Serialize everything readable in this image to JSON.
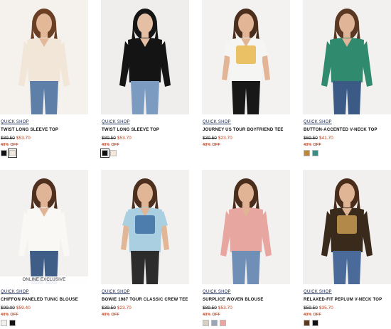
{
  "products": [
    {
      "quick_shop": "QUICK SHOP",
      "name": "TWIST LONG SLEEVE TOP",
      "was_price": "$89.50",
      "now_price": "$53.70",
      "discount": "40% OFF",
      "badge": "",
      "swatches": [
        "#111111",
        "#f3e6da"
      ],
      "colors": {
        "bg": "#f5f2ee",
        "skin": "#e2b899",
        "hair": "#6b3f23",
        "top": "#f1e6d8",
        "bottom": "#5d7fa8",
        "long_sleeve": true
      }
    },
    {
      "quick_shop": "QUICK SHOP",
      "name": "TWIST LONG SLEEVE TOP",
      "was_price": "$89.50",
      "now_price": "$53.70",
      "discount": "40% OFF",
      "badge": "",
      "swatches": [
        "#111111",
        "#f3e6da"
      ],
      "colors": {
        "bg": "#efeeed",
        "skin": "#e5bfa3",
        "hair": "#151515",
        "top": "#141414",
        "bottom": "#7c9bc0",
        "long_sleeve": true
      }
    },
    {
      "quick_shop": "QUICK SHOP",
      "name": "JOURNEY US TOUR BOYFRIEND TEE",
      "was_price": "$39.50",
      "now_price": "$23.70",
      "discount": "40% OFF",
      "badge": "",
      "swatches": [],
      "colors": {
        "bg": "#f4f2f0",
        "skin": "#e1b595",
        "hair": "#4b2e1c",
        "top": "#f5f5f3",
        "bottom": "#181818",
        "long_sleeve": false,
        "graphic": "#e7b74a"
      }
    },
    {
      "quick_shop": "QUICK SHOP",
      "name": "BUTTON-ACCENTED V-NECK TOP",
      "was_price": "$69.50",
      "now_price": "$41.70",
      "discount": "40% OFF",
      "badge": "",
      "swatches": [
        "#b9873d",
        "#3b8c82"
      ],
      "colors": {
        "bg": "#f2f1ef",
        "skin": "#e0b597",
        "hair": "#5a3823",
        "top": "#2f8a6e",
        "bottom": "#3c5a86",
        "long_sleeve": true
      }
    },
    {
      "quick_shop": "QUICK SHOP",
      "name": "CHIFFON PANELED TUNIC BLOUSE",
      "was_price": "$99.00",
      "now_price": "$59.40",
      "discount": "40% OFF",
      "badge": "ONLINE EXCLUSIVE",
      "swatches": [
        "#f3f0ec",
        "#111111"
      ],
      "colors": {
        "bg": "#f3f1ef",
        "skin": "#e0b597",
        "hair": "#4f2f1d",
        "top": "#faf8f4",
        "bottom": "#3f5e87",
        "long_sleeve": true
      }
    },
    {
      "quick_shop": "QUICK SHOP",
      "name": "BOWIE 1987 TOUR CLASSIC CREW TEE",
      "was_price": "$39.50",
      "now_price": "$23.70",
      "discount": "40% OFF",
      "badge": "",
      "swatches": [],
      "colors": {
        "bg": "#f2f1ef",
        "skin": "#e1b697",
        "hair": "#4d2f1d",
        "top": "#a9cfe0",
        "bottom": "#2c2c2c",
        "long_sleeve": false,
        "graphic": "#3d6ea3"
      }
    },
    {
      "quick_shop": "QUICK SHOP",
      "name": "SURPLICE WOVEN BLOUSE",
      "was_price": "$89.50",
      "now_price": "$53.70",
      "discount": "40% OFF",
      "badge": "",
      "swatches": [
        "#d8d2c6",
        "#9aa6b8",
        "#e9a7a4"
      ],
      "colors": {
        "bg": "#f3f1ef",
        "skin": "#e0b495",
        "hair": "#4b2d1b",
        "top": "#e7a6a0",
        "bottom": "#6f8fb6",
        "long_sleeve": true
      }
    },
    {
      "quick_shop": "QUICK SHOP",
      "name": "RELAXED-FIT PEPLUM V-NECK TOP",
      "was_price": "$59.50",
      "now_price": "$35.70",
      "discount": "40% OFF",
      "badge": "",
      "swatches": [
        "#5b3a22",
        "#111111"
      ],
      "colors": {
        "bg": "#f2f0ee",
        "skin": "#e0b596",
        "hair": "#4a2c1a",
        "top": "#3a2a1c",
        "bottom": "#4a6a99",
        "long_sleeve": true,
        "graphic": "#c99a52"
      }
    }
  ]
}
